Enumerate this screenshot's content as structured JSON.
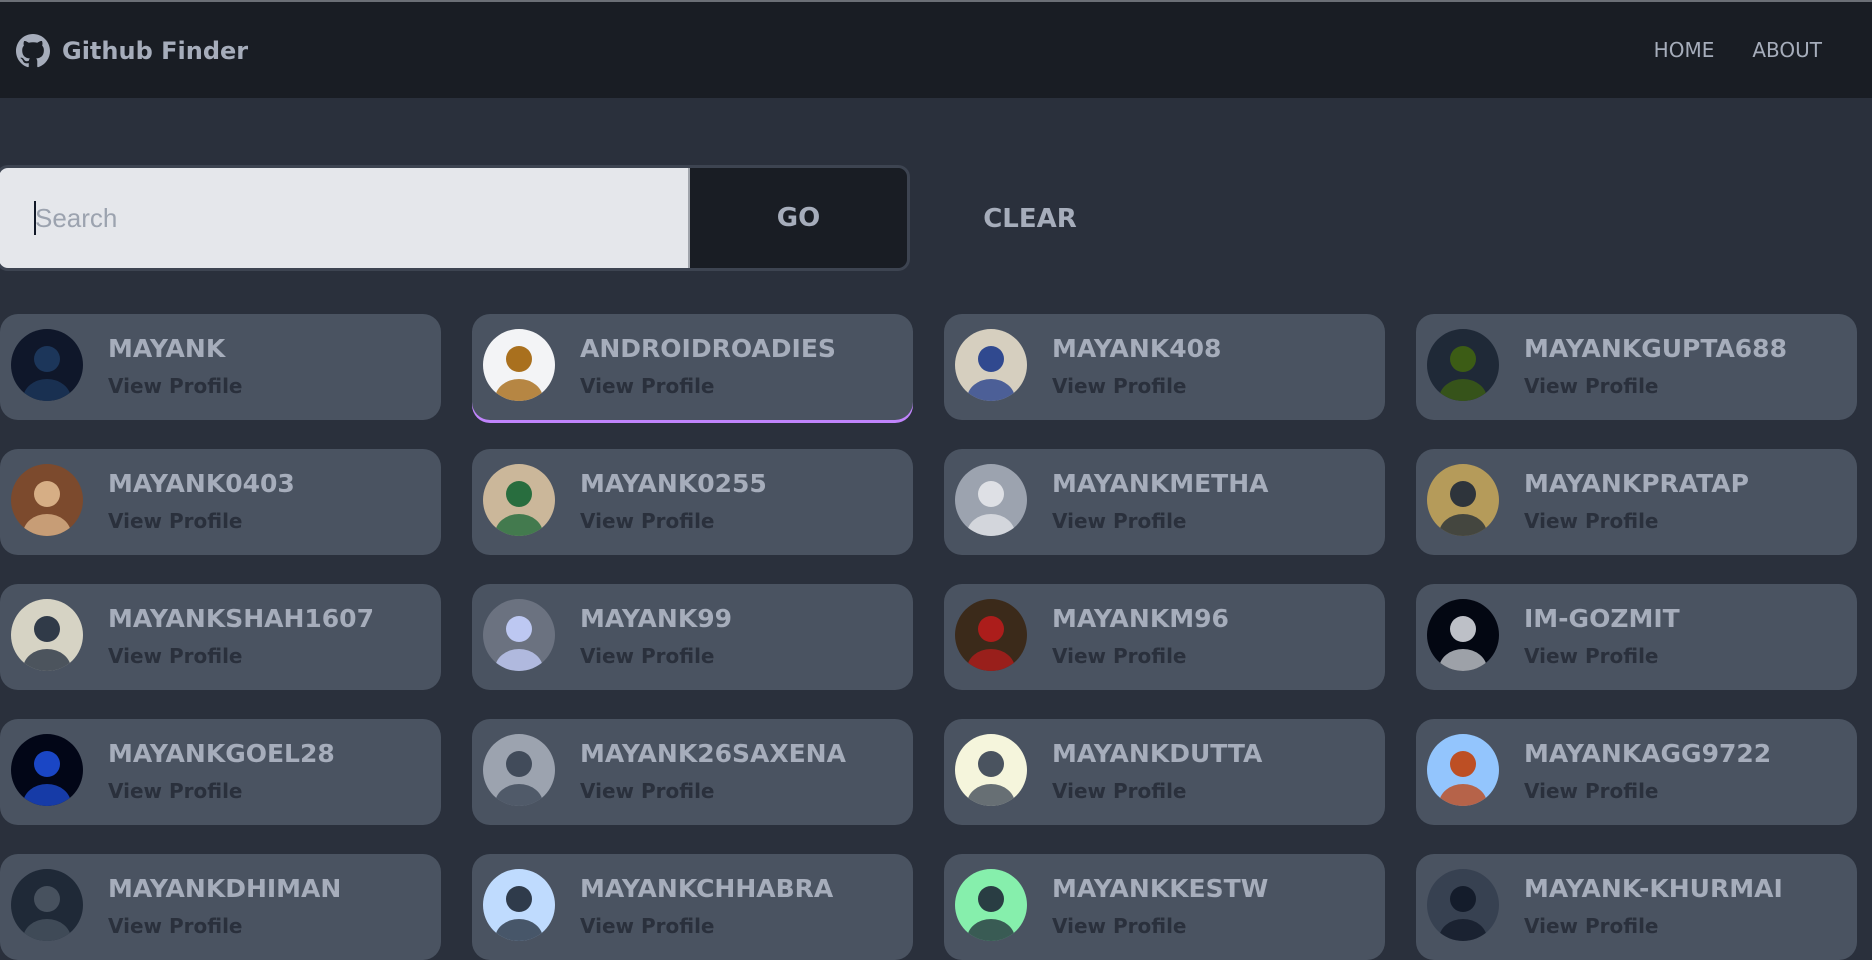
{
  "navbar": {
    "brand": "Github Finder",
    "links": [
      "HOME",
      "ABOUT"
    ]
  },
  "search": {
    "placeholder": "Search",
    "value": "",
    "go_label": "GO",
    "clear_label": "CLEAR"
  },
  "users": [
    {
      "login": "MAYANK",
      "link": "View Profile",
      "avatar_bg": "#0f172a",
      "avatar_fg": "#1e3a5f"
    },
    {
      "login": "ANDROIDROADIES",
      "link": "View Profile",
      "avatar_bg": "#f3f4f6",
      "avatar_fg": "#a16207"
    },
    {
      "login": "MAYANK408",
      "link": "View Profile",
      "avatar_bg": "#d6cfbf",
      "avatar_fg": "#1e3a8a"
    },
    {
      "login": "MAYANKGUPTA688",
      "link": "View Profile",
      "avatar_bg": "#1f2937",
      "avatar_fg": "#3f6212"
    },
    {
      "login": "MAYANK0403",
      "link": "View Profile",
      "avatar_bg": "#7c4a2d",
      "avatar_fg": "#e0b98f"
    },
    {
      "login": "MAYANK0255",
      "link": "View Profile",
      "avatar_bg": "#cbb79a",
      "avatar_fg": "#166534"
    },
    {
      "login": "MAYANKMETHA",
      "link": "View Profile",
      "avatar_bg": "#9ca3af",
      "avatar_fg": "#e5e7eb"
    },
    {
      "login": "MAYANKPRATAP",
      "link": "View Profile",
      "avatar_bg": "#b59b5a",
      "avatar_fg": "#1f2937"
    },
    {
      "login": "MAYANKSHAH1607",
      "link": "View Profile",
      "avatar_bg": "#d6d3c4",
      "avatar_fg": "#1e293b"
    },
    {
      "login": "MAYANK99",
      "link": "View Profile",
      "avatar_bg": "#6b7280",
      "avatar_fg": "#c7d2fe"
    },
    {
      "login": "MAYANKM96",
      "link": "View Profile",
      "avatar_bg": "#3b2a1a",
      "avatar_fg": "#b91c1c"
    },
    {
      "login": "IM-GOZMIT",
      "link": "View Profile",
      "avatar_bg": "#030712",
      "avatar_fg": "#d1d5db"
    },
    {
      "login": "MAYANKGOEL28",
      "link": "View Profile",
      "avatar_bg": "#020617",
      "avatar_fg": "#1d4ed8"
    },
    {
      "login": "MAYANK26SAXENA",
      "link": "View Profile",
      "avatar_bg": "#9ca3af",
      "avatar_fg": "#374151"
    },
    {
      "login": "MAYANKDUTTA",
      "link": "View Profile",
      "avatar_bg": "#f5f5dc",
      "avatar_fg": "#374151"
    },
    {
      "login": "MAYANKAGG9722",
      "link": "View Profile",
      "avatar_bg": "#93c5fd",
      "avatar_fg": "#c2410c"
    },
    {
      "login": "MAYANKDHIMAN",
      "link": "View Profile",
      "avatar_bg": "#1f2937",
      "avatar_fg": "#4b5563"
    },
    {
      "login": "MAYANKCHHABRA",
      "link": "View Profile",
      "avatar_bg": "#bfdbfe",
      "avatar_fg": "#1f2937"
    },
    {
      "login": "MAYANKKESTW",
      "link": "View Profile",
      "avatar_bg": "#86efac",
      "avatar_fg": "#1f2937"
    },
    {
      "login": "MAYANK-KHURMAI",
      "link": "View Profile",
      "avatar_bg": "#374151",
      "avatar_fg": "#111827"
    }
  ],
  "colors": {
    "accent_underline": "#c084fc"
  }
}
